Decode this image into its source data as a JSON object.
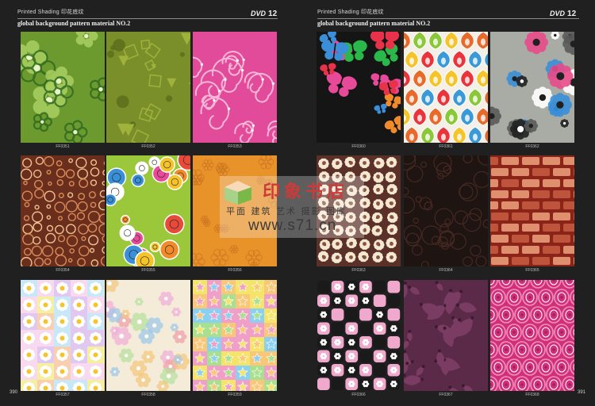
{
  "left_page": {
    "header": "Printed Shading 印花底纹",
    "dvd_label": "DVD",
    "dvd_number": "12",
    "subtitle": "global background pattern material NO.2",
    "page_number": "390",
    "tiles": [
      {
        "code": "FF0351",
        "pattern": "green-flower-outlines",
        "colors": [
          "#6d9a2e",
          "#a9cf62",
          "#2f6a1f"
        ]
      },
      {
        "code": "FF0352",
        "pattern": "olive-geometric",
        "colors": [
          "#7a8e2a",
          "#9fb23c",
          "#5c6d1c"
        ]
      },
      {
        "code": "FF0353",
        "pattern": "pink-swirls",
        "colors": [
          "#e24a9a",
          "#f6b6d8",
          "#c22f7c"
        ]
      },
      {
        "code": "FF0354",
        "pattern": "brown-bubbles",
        "colors": [
          "#6a2f1c",
          "#d98a5a",
          "#f0c090"
        ]
      },
      {
        "code": "FF0355",
        "pattern": "colorful-buttons",
        "colors": [
          "#9bc83a",
          "#e84a3a",
          "#3a8fd8"
        ]
      },
      {
        "code": "FF0356",
        "pattern": "orange-doodle",
        "colors": [
          "#e8922a",
          "#f2b04a",
          "#c87420"
        ]
      },
      {
        "code": "FF0357",
        "pattern": "daisy-squares",
        "colors": [
          "#f7d9f0",
          "#f4f0a0",
          "#e0c8f0"
        ]
      },
      {
        "code": "FF0358",
        "pattern": "pastel-flowers",
        "colors": [
          "#f4ecd8",
          "#f0a0a8",
          "#a0c8e8"
        ]
      },
      {
        "code": "FF0359",
        "pattern": "star-checker",
        "colors": [
          "#f4e46a",
          "#8cd0f0",
          "#f0a0c8"
        ]
      }
    ]
  },
  "right_page": {
    "header": "Printed Shading 印花底纹",
    "dvd_label": "DVD",
    "dvd_number": "12",
    "subtitle": "global background pattern material NO.2",
    "page_number": "391",
    "tiles": [
      {
        "code": "FF0360",
        "pattern": "butterflies",
        "colors": [
          "#151515",
          "#e8324a",
          "#7a3cd8"
        ]
      },
      {
        "code": "FF0361",
        "pattern": "ogee-drops",
        "colors": [
          "#e8343a",
          "#8ac83a",
          "#f4c42a"
        ]
      },
      {
        "code": "FF0362",
        "pattern": "gray-flowers",
        "colors": [
          "#a8aca4",
          "#202020",
          "#e84a8a"
        ]
      },
      {
        "code": "FF0363",
        "pattern": "brown-daisies",
        "colors": [
          "#5a3028",
          "#f4e8d0",
          "#8a5040"
        ]
      },
      {
        "code": "FF0364",
        "pattern": "dark-network",
        "colors": [
          "#1e1412",
          "#4a2a22",
          "#2a1c18"
        ]
      },
      {
        "code": "FF0365",
        "pattern": "red-blocks",
        "colors": [
          "#8a2418",
          "#c45a40",
          "#e89a78"
        ]
      },
      {
        "code": "FF0366",
        "pattern": "pink-black-checker",
        "colors": [
          "#f0a8cc",
          "#1a1a1a",
          "#ffffff"
        ]
      },
      {
        "code": "FF0367",
        "pattern": "purple-damask",
        "colors": [
          "#5a2a48",
          "#7a3c62",
          "#3c1a30"
        ]
      },
      {
        "code": "FF0368",
        "pattern": "pink-ovals",
        "colors": [
          "#d0307a",
          "#f290bc",
          "#a02060"
        ]
      }
    ]
  },
  "watermark": {
    "brand": "印象书店",
    "tagline": "平面 建筑 艺术 摄影 图库",
    "url": "www.s71.cn",
    "colors": {
      "brand": "#cc3a3a",
      "logo": "#7ab84a"
    }
  }
}
